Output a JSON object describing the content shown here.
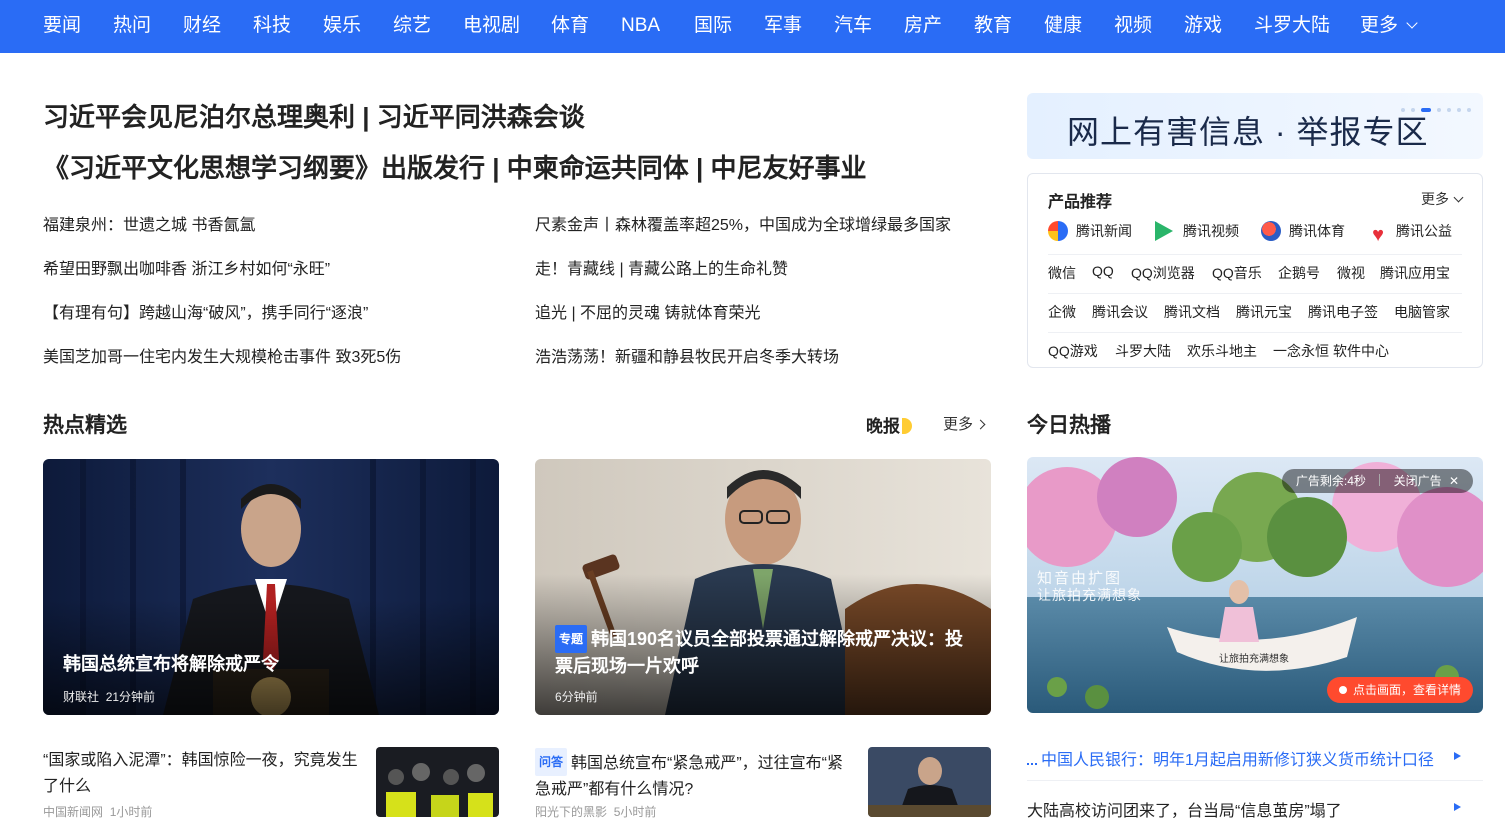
{
  "nav": {
    "items": [
      "要闻",
      "热问",
      "财经",
      "科技",
      "娱乐",
      "综艺",
      "电视剧",
      "体育",
      "NBA",
      "国际",
      "军事",
      "汽车",
      "房产",
      "教育",
      "健康",
      "视频",
      "游戏",
      "斗罗大陆"
    ],
    "more": "更多"
  },
  "headlines": [
    "习近平会见尼泊尔总理奥利 | 习近平同洪森会谈",
    "《习近平文化思想学习纲要》出版发行 | 中柬命运共同体 | 中尼友好事业"
  ],
  "news_left": [
    "福建泉州：世遗之城 书香氤氲",
    "希望田野飘出咖啡香 浙江乡村如何“永旺”",
    "【有理有句】跨越山海“破风”，携手同行“逐浪”",
    "美国芝加哥一住宅内发生大规模枪击事件 致3死5伤"
  ],
  "news_right": [
    "尺素金声丨森林覆盖率超25%，中国成为全球增绿最多国家",
    "走！青藏线 | 青藏公路上的生命礼赞",
    "追光 | 不屈的灵魂 铸就体育荣光",
    "浩浩荡荡！新疆和静县牧民开启冬季大转场"
  ],
  "hot": {
    "title": "热点精选",
    "evening": "晚报",
    "more": "更多"
  },
  "cards": [
    {
      "caption": "韩国总统宣布将解除戒严令",
      "source": "财联社",
      "time": "21分钟前"
    },
    {
      "tag": "专题",
      "caption": "韩国190名议员全部投票通过解除戒严决议：投票后现场一片欢呼",
      "time": "6分钟前"
    }
  ],
  "list_items": [
    {
      "title": "“国家或陷入泥潭”：韩国惊险一夜，究竟发生了什么",
      "source": "中国新闻网",
      "time": "1小时前"
    },
    {
      "tag": "问答",
      "title": "韩国总统宣布“紧急戒严”，过往宣布“紧急戒严”都有什么情况?",
      "source": "阳光下的黑影",
      "time": "5小时前"
    }
  ],
  "report_banner": "网上有害信息 · 举报专区",
  "products": {
    "title": "产品推荐",
    "more": "更多",
    "featured": [
      "腾讯新闻",
      "腾讯视频",
      "腾讯体育",
      "腾讯公益"
    ],
    "row1": [
      "微信",
      "QQ",
      "QQ浏览器",
      "QQ音乐",
      "企鹅号",
      "微视",
      "腾讯应用宝"
    ],
    "row2": [
      "企微",
      "腾讯会议",
      "腾讯文档",
      "腾讯元宝",
      "腾讯电子签",
      "电脑管家"
    ],
    "row3": [
      "QQ游戏",
      "斗罗大陆",
      "欢乐斗地主",
      "一念永恒",
      "软件中心"
    ]
  },
  "today_hot": {
    "title": "今日热播",
    "ad_remaining_label": "广告剩余:",
    "ad_remaining_value": "4秒",
    "ad_close": "关闭广告",
    "ad_overlay_line1": "知音由扩图",
    "ad_overlay_line2": "让旅拍充满想象",
    "ad_center_text": "让旅拍充满想象",
    "ad_cta": "点击画面，查看详情",
    "items": [
      "中国人民银行：明年1月起启用新修订狭义货币统计口径",
      "大陆高校访问团来了，台当局“信息茧房”塌了"
    ]
  },
  "colors": {
    "nav": "#2a6cf5",
    "accent": "#2a6cf5",
    "ad_cta": "#ff4a2e"
  }
}
